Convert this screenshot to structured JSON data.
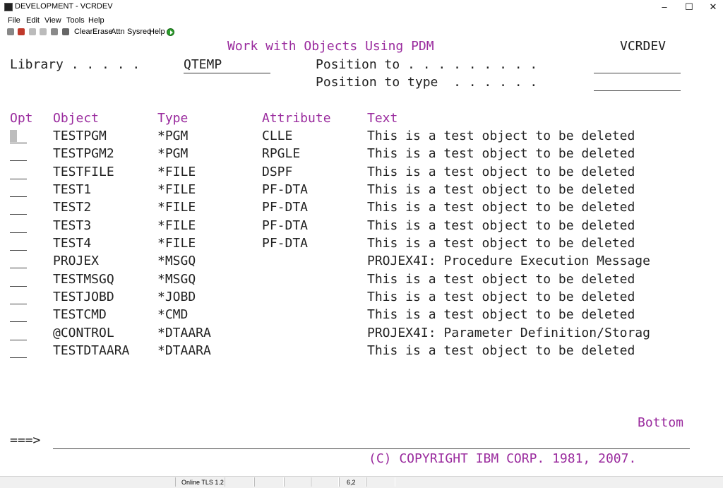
{
  "window": {
    "title": "DEVELOPMENT - VCRDEV",
    "minimize": "–",
    "maximize": "☐",
    "close": "✕"
  },
  "menu": [
    "File",
    "Edit",
    "View",
    "Tools",
    "Help"
  ],
  "toolbar": [
    "Clear",
    "Erase",
    "Attn",
    "Sysreq",
    "Help"
  ],
  "screen": {
    "title": "Work with Objects Using PDM",
    "system": "VCRDEV",
    "library_label": "Library . . . . .",
    "library_value": "QTEMP",
    "position_to_label": "Position to . . . . . . . . .",
    "position_to_type_label": "Position to type  . . . . . .",
    "headers": {
      "opt": "Opt",
      "object": "Object",
      "type": "Type",
      "attribute": "Attribute",
      "text": "Text"
    },
    "rows": [
      {
        "object": "TESTPGM",
        "type": "*PGM",
        "attribute": "CLLE",
        "text": "This is a test object to be deleted"
      },
      {
        "object": "TESTPGM2",
        "type": "*PGM",
        "attribute": "RPGLE",
        "text": "This is a test object to be deleted"
      },
      {
        "object": "TESTFILE",
        "type": "*FILE",
        "attribute": "DSPF",
        "text": "This is a test object to be deleted"
      },
      {
        "object": "TEST1",
        "type": "*FILE",
        "attribute": "PF-DTA",
        "text": "This is a test object to be deleted"
      },
      {
        "object": "TEST2",
        "type": "*FILE",
        "attribute": "PF-DTA",
        "text": "This is a test object to be deleted"
      },
      {
        "object": "TEST3",
        "type": "*FILE",
        "attribute": "PF-DTA",
        "text": "This is a test object to be deleted"
      },
      {
        "object": "TEST4",
        "type": "*FILE",
        "attribute": "PF-DTA",
        "text": "This is a test object to be deleted"
      },
      {
        "object": "PROJEX",
        "type": "*MSGQ",
        "attribute": "",
        "text": "PROJEX4I: Procedure Execution Message"
      },
      {
        "object": "TESTMSGQ",
        "type": "*MSGQ",
        "attribute": "",
        "text": "This is a test object to be deleted"
      },
      {
        "object": "TESTJOBD",
        "type": "*JOBD",
        "attribute": "",
        "text": "This is a test object to be deleted"
      },
      {
        "object": "TESTCMD",
        "type": "*CMD",
        "attribute": "",
        "text": "This is a test object to be deleted"
      },
      {
        "object": "@CONTROL",
        "type": "*DTAARA",
        "attribute": "",
        "text": "PROJEX4I: Parameter Definition/Storag"
      },
      {
        "object": "TESTDTAARA",
        "type": "*DTAARA",
        "attribute": "",
        "text": "This is a test object to be deleted"
      }
    ],
    "bottom": "Bottom",
    "prompt": "===>",
    "copyright": "(C) COPYRIGHT IBM CORP. 1981, 2007."
  },
  "statusbar": {
    "connection": "Online TLS 1.2",
    "cursor": "6,2"
  }
}
